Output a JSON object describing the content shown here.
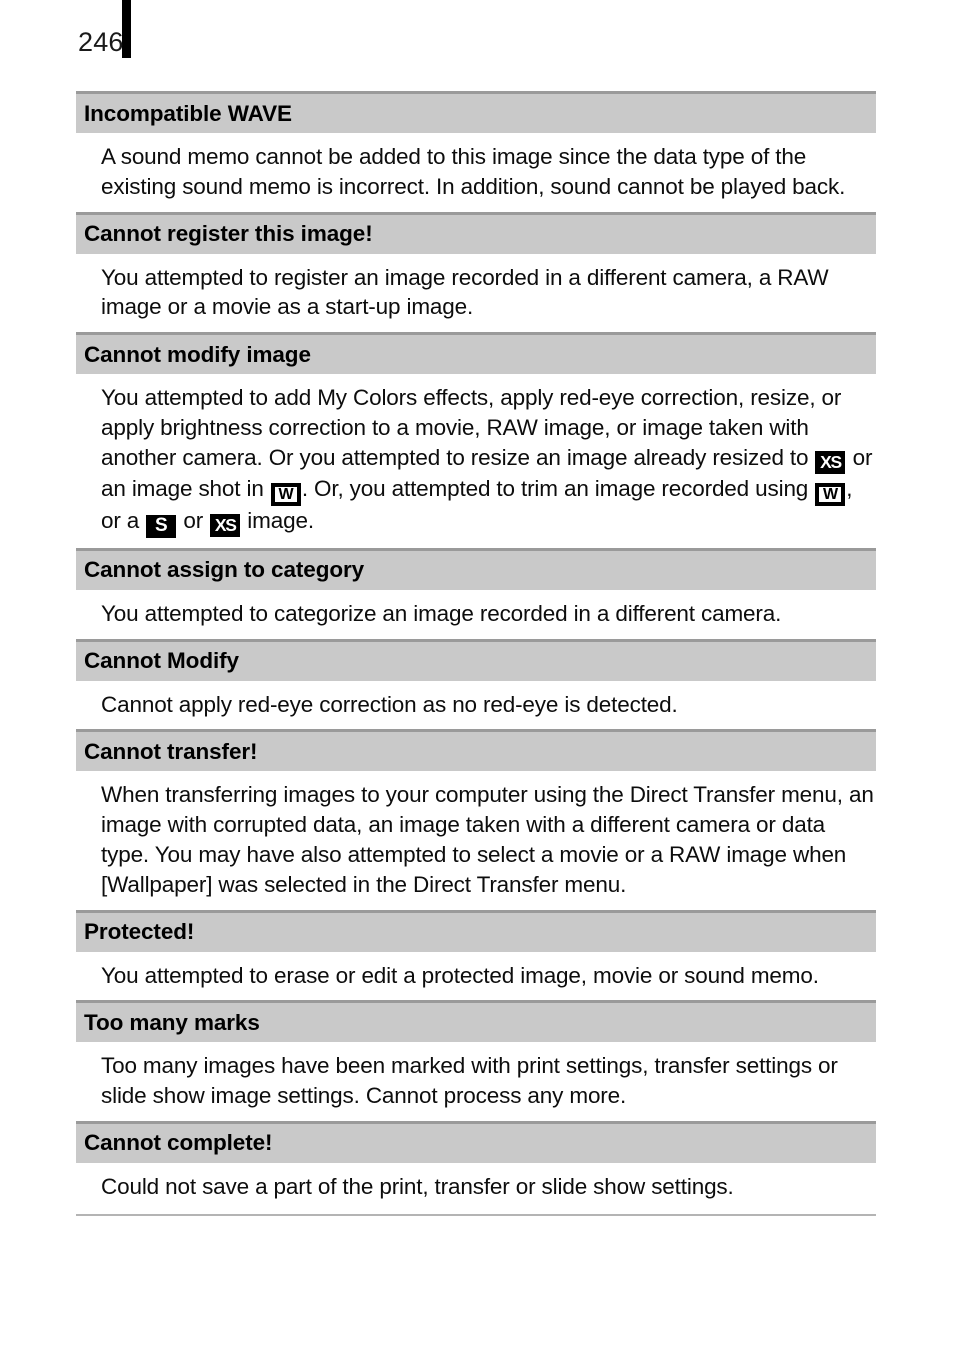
{
  "page": {
    "number": "246",
    "rule_color": "#000000"
  },
  "theme": {
    "header_bg": "#c9c9c9",
    "section_rule": "#9a9a9a",
    "bottom_rule": "#b4b4b4",
    "text": "#000000",
    "page_bg": "#ffffff"
  },
  "icons": {
    "xs": {
      "label": "XS",
      "name": "resolution-xs-icon",
      "style": "dark"
    },
    "w": {
      "label": "W",
      "name": "resolution-widescreen-icon",
      "style": "light"
    },
    "s": {
      "label": "S",
      "name": "resolution-s-icon",
      "style": "dark"
    }
  },
  "messages": [
    {
      "title": "Incompatible WAVE",
      "body_parts": [
        {
          "type": "text",
          "value": "A sound memo cannot be added to this image since the data type of the existing sound memo is incorrect. In addition, sound cannot be played back."
        }
      ]
    },
    {
      "title": "Cannot register this image!",
      "body_parts": [
        {
          "type": "text",
          "value": "You attempted to register an image recorded in a different camera, a RAW image or a movie as a start-up image."
        }
      ]
    },
    {
      "title": "Cannot modify image",
      "body_parts": [
        {
          "type": "text",
          "value": "You attempted to add My Colors effects, apply red-eye correction, resize, or apply brightness correction to a movie, RAW image, or image taken with another camera. Or you attempted to resize an image already resized to "
        },
        {
          "type": "icon",
          "value": "xs"
        },
        {
          "type": "text",
          "value": " or an image shot in "
        },
        {
          "type": "icon",
          "value": "w"
        },
        {
          "type": "text",
          "value": ". Or, you attempted to trim an image recorded using "
        },
        {
          "type": "icon",
          "value": "w"
        },
        {
          "type": "text",
          "value": ", or a "
        },
        {
          "type": "icon",
          "value": "s"
        },
        {
          "type": "text",
          "value": " or "
        },
        {
          "type": "icon",
          "value": "xs"
        },
        {
          "type": "text",
          "value": " image."
        }
      ]
    },
    {
      "title": "Cannot assign to category",
      "body_parts": [
        {
          "type": "text",
          "value": "You attempted to categorize an image recorded in a different camera."
        }
      ]
    },
    {
      "title": "Cannot Modify",
      "body_parts": [
        {
          "type": "text",
          "value": "Cannot apply red-eye correction as no red-eye is detected."
        }
      ]
    },
    {
      "title": "Cannot transfer!",
      "body_parts": [
        {
          "type": "text",
          "value": "When transferring images to your computer using the Direct Transfer menu, an image with corrupted data, an image taken with a different camera or data type. You may have also attempted to select a movie or a RAW image when [Wallpaper] was selected in the Direct Transfer menu."
        }
      ]
    },
    {
      "title": "Protected!",
      "body_parts": [
        {
          "type": "text",
          "value": "You attempted to erase or edit a protected image, movie or sound memo."
        }
      ]
    },
    {
      "title": "Too many marks",
      "body_parts": [
        {
          "type": "text",
          "value": "Too many images have been marked with print settings, transfer settings or slide show image settings. Cannot process any more."
        }
      ]
    },
    {
      "title": "Cannot complete!",
      "body_parts": [
        {
          "type": "text",
          "value": "Could not save a part of the print, transfer or slide show settings."
        }
      ]
    }
  ]
}
